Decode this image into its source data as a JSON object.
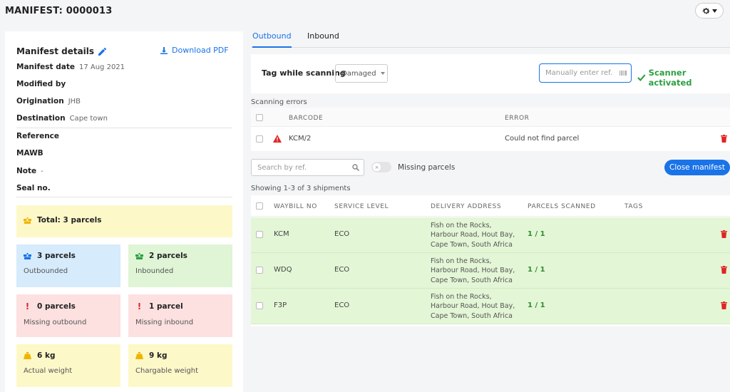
{
  "header": {
    "title": "MANIFEST: 0000013"
  },
  "details": {
    "title": "Manifest details",
    "download_label": "Download PDF",
    "fields": {
      "manifest_date": {
        "label": "Manifest date",
        "value": "17 Aug 2021"
      },
      "modified_by": {
        "label": "Modified by",
        "value": ""
      },
      "origination": {
        "label": "Origination",
        "value": "JHB"
      },
      "destination": {
        "label": "Destination",
        "value": "Cape town"
      },
      "reference": {
        "label": "Reference",
        "value": ""
      },
      "mawb": {
        "label": "MAWB",
        "value": ""
      },
      "note": {
        "label": "Note",
        "value": "-"
      },
      "seal_no": {
        "label": "Seal no.",
        "value": ""
      }
    }
  },
  "stats": {
    "total": {
      "value": "Total: 3 parcels"
    },
    "outbounded": {
      "value": "3 parcels",
      "label": "Outbounded"
    },
    "inbounded": {
      "value": "2 parcels",
      "label": "Inbounded"
    },
    "missing_outbound": {
      "value": "0 parcels",
      "label": "Missing outbound"
    },
    "missing_inbound": {
      "value": "1 parcel",
      "label": "Missing inbound"
    },
    "actual_weight": {
      "value": "6 kg",
      "label": "Actual weight"
    },
    "chargable_weight": {
      "value": "9 kg",
      "label": "Chargable weight"
    }
  },
  "tabs": [
    {
      "label": "Outbound"
    },
    {
      "label": "Inbound"
    }
  ],
  "scanning": {
    "tag_label": "Tag while scanning",
    "tag_value": "Damaged",
    "manual_placeholder": "Manually enter ref.",
    "status": "Scanner activated"
  },
  "errors": {
    "section_label": "Scanning errors",
    "headers": {
      "barcode": "BARCODE",
      "error": "ERROR"
    },
    "rows": [
      {
        "barcode": "KCM/2",
        "error": "Could not find parcel"
      }
    ]
  },
  "shipments": {
    "search_placeholder": "Search by ref.",
    "missing_toggle_label": "Missing parcels",
    "close_label": "Close manifest",
    "summary": "Showing 1-3 of 3 shipments",
    "headers": {
      "waybill": "WAYBILL NO",
      "service": "SERVICE LEVEL",
      "address": "DELIVERY ADDRESS",
      "parcels": "PARCELS SCANNED",
      "tags": "TAGS"
    },
    "rows": [
      {
        "waybill": "KCM",
        "service": "ECO",
        "address_1": "Fish on the Rocks,",
        "address_2": "Harbour Road, Hout Bay,",
        "address_3": "Cape Town, South Africa",
        "parcels": "1 / 1"
      },
      {
        "waybill": "WDQ",
        "service": "ECO",
        "address_1": "Fish on the Rocks,",
        "address_2": "Harbour Road, Hout Bay,",
        "address_3": "Cape Town, South Africa",
        "parcels": "1 / 1"
      },
      {
        "waybill": "F3P",
        "service": "ECO",
        "address_1": "Fish on the Rocks,",
        "address_2": "Harbour Road, Hout Bay,",
        "address_3": "Cape Town, South Africa",
        "parcels": "1 / 1"
      }
    ]
  },
  "colors": {
    "accent": "#1a73e8",
    "success": "#2ea043",
    "danger": "#e02424",
    "row_highlight": "#e3f6d6"
  }
}
